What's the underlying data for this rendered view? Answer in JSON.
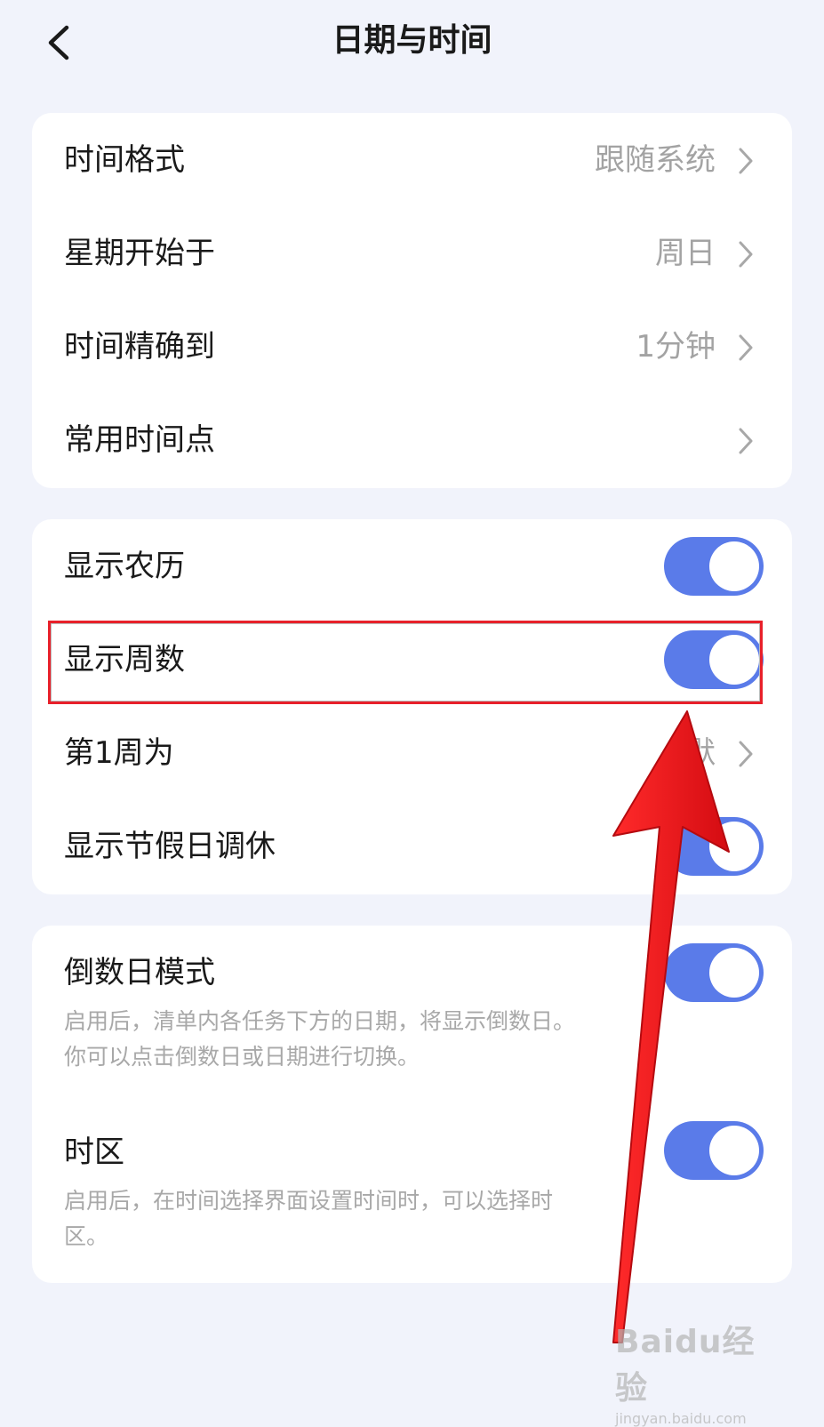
{
  "header": {
    "back_icon": "chevron-left-icon",
    "title": "日期与时间"
  },
  "group1": {
    "rows": [
      {
        "label": "时间格式",
        "value": "跟随系统"
      },
      {
        "label": "星期开始于",
        "value": "周日"
      },
      {
        "label": "时间精确到",
        "value": "1分钟"
      },
      {
        "label": "常用时间点",
        "value": ""
      }
    ]
  },
  "group2": {
    "rows": [
      {
        "label": "显示农历",
        "toggle": true
      },
      {
        "label": "显示周数",
        "toggle": true
      },
      {
        "label": "第1周为",
        "value": "默"
      },
      {
        "label": "显示节假日调休",
        "toggle": true
      }
    ]
  },
  "group3": {
    "rows": [
      {
        "label": "倒数日模式",
        "desc_line1": "启用后，清单内各任务下方的日期，将显示倒数日。",
        "desc_line2": "你可以点击倒数日或日期进行切换。",
        "toggle": true
      },
      {
        "label": "时区",
        "desc_line1": "启用后，在时间选择界面设置时间时，可以选择时",
        "desc_line2": "区。",
        "toggle": true
      }
    ]
  },
  "colors": {
    "accent": "#5a7be9",
    "annotation": "#e8202a",
    "background": "#f1f3fb"
  },
  "watermark": {
    "logo": "Baidu经验",
    "url": "jingyan.baidu.com"
  }
}
